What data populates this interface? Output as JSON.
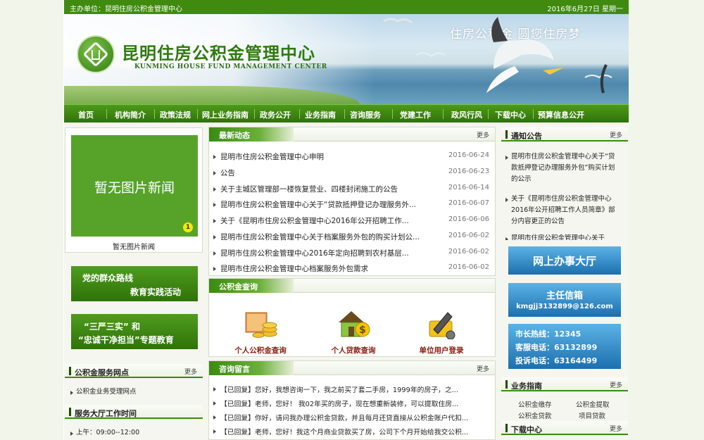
{
  "topbar": {
    "left": "主办单位：昆明住房公积金管理中心",
    "right": "2016年6月27日 星期一"
  },
  "banner": {
    "title": "昆明住房公积金管理中心",
    "subtitle": "KUNMING HOUSE FUND MANAGEMENT CENTER",
    "slogan": "住房公积金 圆您住房梦"
  },
  "nav": [
    "首页",
    "机构简介",
    "政策法规",
    "网上业务指南",
    "政务公开",
    "业务指南",
    "咨询服务",
    "党建工作",
    "政风行风",
    "下载中心",
    "预算信息公开"
  ],
  "pic_news": {
    "placeholder": "暂无图片新闻",
    "badge": "1",
    "caption": "暂无图片新闻"
  },
  "promos": [
    {
      "line1": "党的群众路线",
      "line2": "教育实践活动"
    },
    {
      "line1": "“三严三实” 和",
      "line2": "“忠诚干净担当”专题教育"
    }
  ],
  "left_sections": [
    {
      "title": "公积金服务网点",
      "more": "更多",
      "items": [
        "公积金业务受理网点"
      ]
    },
    {
      "title": "服务大厅工作时间",
      "items": [
        "上午：09:00--12:00"
      ]
    }
  ],
  "latest": {
    "title": "最新动态",
    "more": "更多",
    "items": [
      {
        "t": "昆明市住房公积金管理中心申明",
        "d": "2016-06-24"
      },
      {
        "t": "公告",
        "d": "2016-06-23"
      },
      {
        "t": "关于主城区管理部一楼恢复营业、四楼封闭施工的公告",
        "d": "2016-06-14"
      },
      {
        "t": "昆明市住房公积金管理中心关于“贷款抵押登记办理服务外...",
        "d": "2016-06-07"
      },
      {
        "t": "关于《昆明市住房公积金管理中心2016年公开招聘工作...",
        "d": "2016-06-06"
      },
      {
        "t": "昆明市住房公积金管理中心关于档案服务外包的购买计划公...",
        "d": "2016-06-02"
      },
      {
        "t": "昆明市住房公积金管理中心2016年定向招聘到农村基层...",
        "d": "2016-06-02"
      },
      {
        "t": "昆明市住房公积金管理中心档案服务外包需求",
        "d": "2016-06-02"
      }
    ]
  },
  "query": {
    "title": "公积金查询",
    "items": [
      "个人公积金查询",
      "个人贷款查询",
      "单位用户登录"
    ]
  },
  "consult": {
    "title": "咨询留言",
    "more": "更多",
    "items": [
      "【已回复】您好，我想咨询一下，我之前买了套二手房，1999年的房子，之...",
      "【已回复】老师，您好！ 我02年买的房子，现在想重新装修，可以提取住房...",
      "【已回复】你好，请问我办理公积金贷款，并且每月还贷直接从公积金账户代扣...",
      "【已回复】老师，您好！我这个月商业贷款买了房，公司下个月开始给我交公积..."
    ]
  },
  "notice": {
    "title": "通知公告",
    "more": "更多",
    "items": [
      "昆明市住房公积金管理中心关于“贷款抵押登记办理服务外包”购买计划的公示",
      "关于《昆明市住房公积金管理中心2016年公开招聘工作人员简章》部分内容更正的公告",
      "昆明市住房公积金管理中心关于2016年..."
    ]
  },
  "services": {
    "hall": "网上办事大厅",
    "mailbox_title": "主任信箱",
    "mailbox_email": "kmgjj3132899@126.com",
    "hotline": "市长热线：12345",
    "service_phone": "客服电话：63132899",
    "complaint_phone": "投诉电话：63164499"
  },
  "guide": {
    "title": "业务指南",
    "more": "更多",
    "items": [
      "公积金缴存",
      "公积金提取",
      "公积金贷款",
      "项目贷款"
    ]
  },
  "download": {
    "title": "下载中心",
    "more": "更多"
  }
}
